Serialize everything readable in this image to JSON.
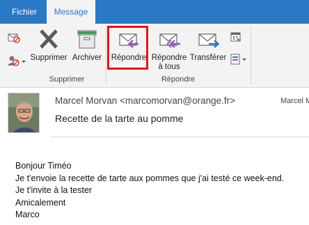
{
  "tabs": [
    {
      "label": "Fichier"
    },
    {
      "label": "Message"
    }
  ],
  "ribbon": {
    "delete_group": {
      "label": "Supprimer",
      "buttons": [
        {
          "label": "Supprimer",
          "icon": "delete-x-icon"
        },
        {
          "label": "Archiver",
          "icon": "archive-icon"
        }
      ],
      "small_icons": [
        "ignore-icon",
        "junk-icon"
      ]
    },
    "reply_group": {
      "label": "Répondre",
      "buttons": [
        {
          "label": "Répondre",
          "icon": "reply-icon"
        },
        {
          "label": "Répondre",
          "label2": "à tous",
          "icon": "reply-all-icon"
        },
        {
          "label": "Transférer",
          "icon": "forward-icon"
        }
      ],
      "small_icons": [
        "meeting-icon",
        "more-respond-icon"
      ]
    },
    "highlight_color": "#e3131c"
  },
  "message": {
    "sender": "Marcel Morvan <marcomorvan@orange.fr>",
    "recipient_short": "Marcel M",
    "subject": "Recette de la tarte au pomme",
    "body_lines": [
      "Bonjour Timéo",
      "Je t'envoie la recette de tarte aux pommes que j'ai testé ce week-end.",
      "Je t'invite à la tester",
      "Amicalement",
      "Marco"
    ]
  },
  "colors": {
    "accent": "#2b78c5",
    "ribbon_bg": "#f3f3f3",
    "reply_arrow": "#8b5bb5",
    "forward_arrow": "#2f78c4"
  }
}
